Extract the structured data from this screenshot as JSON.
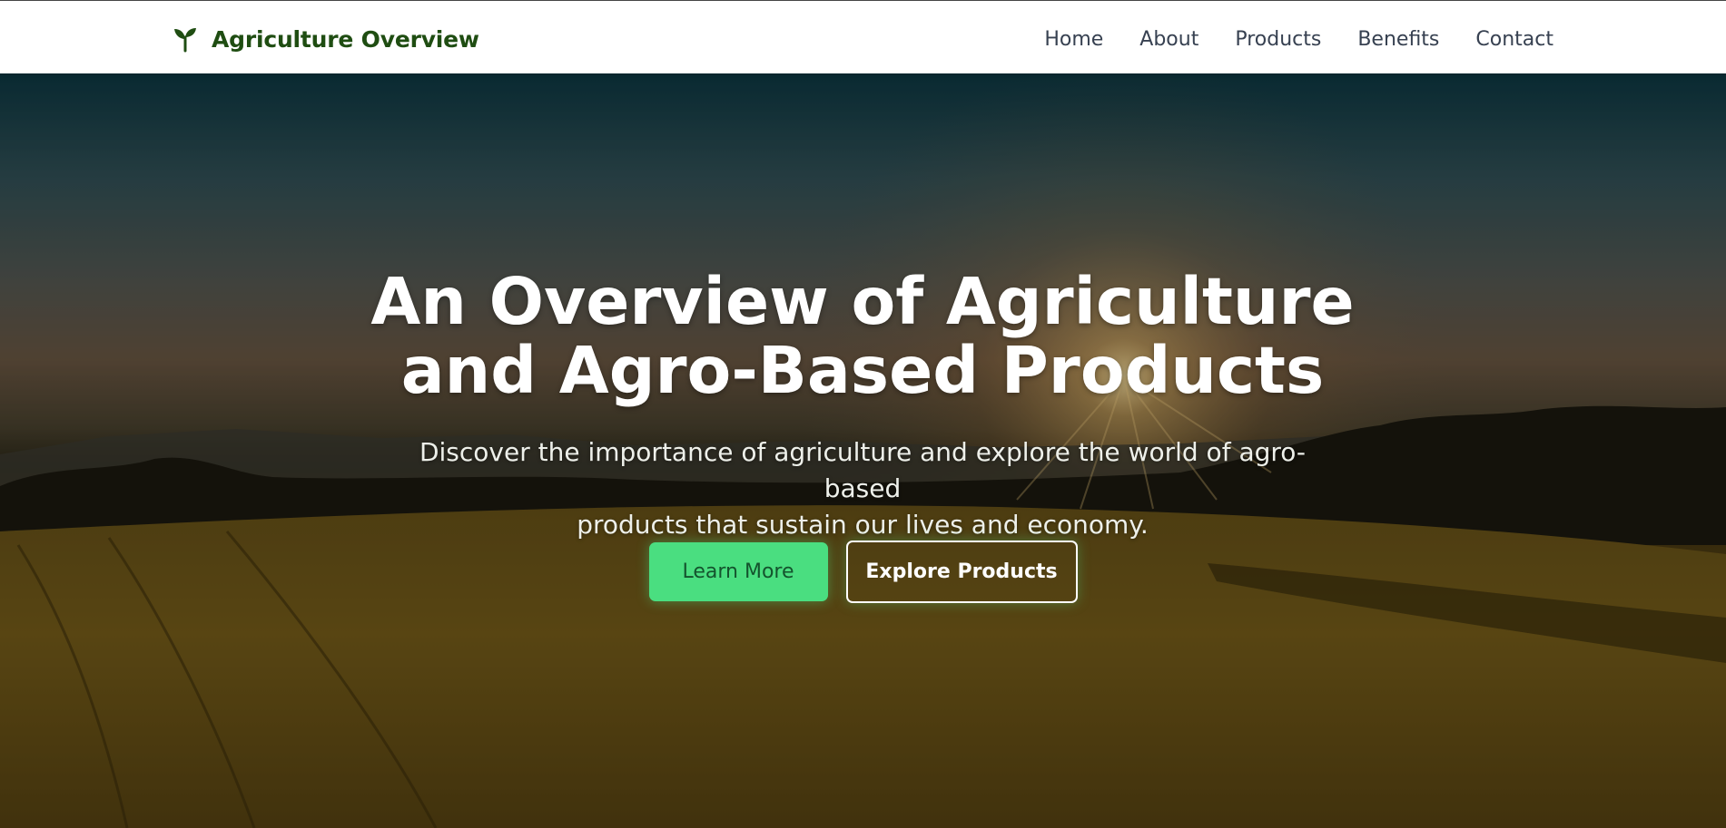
{
  "header": {
    "brand_icon": "sprout-icon",
    "brand_title": "Agriculture Overview",
    "brand_color": "#1f4d12",
    "nav": [
      {
        "label": "Home"
      },
      {
        "label": "About"
      },
      {
        "label": "Products"
      },
      {
        "label": "Benefits"
      },
      {
        "label": "Contact"
      }
    ]
  },
  "hero": {
    "title_line1": "An Overview of Agriculture",
    "title_line2": "and Agro-Based Products",
    "subtitle_line1": "Discover the importance of agriculture and explore the world of agro-based",
    "subtitle_line2": "products that sustain our lives and economy.",
    "primary_button": "Learn More",
    "secondary_button": "Explore Products",
    "accent_color": "#4ade80"
  }
}
